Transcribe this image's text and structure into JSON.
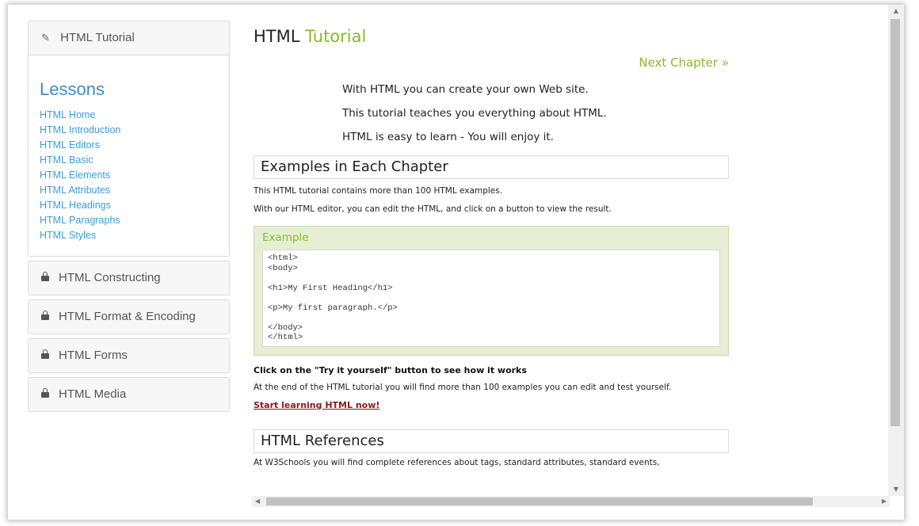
{
  "sidebar": {
    "header_label": "HTML Tutorial",
    "lessons_title": "Lessons",
    "lessons": [
      "HTML Home",
      "HTML Introduction",
      "HTML Editors",
      "HTML Basic",
      "HTML Elements",
      "HTML Attributes",
      "HTML Headings",
      "HTML Paragraphs",
      "HTML Styles"
    ],
    "locked_sections": [
      "HTML Constructing",
      "HTML Format & Encoding",
      "HTML Forms",
      "HTML Media"
    ]
  },
  "main": {
    "title_part1": "HTML",
    "title_part2": "Tutorial",
    "next_chapter": "Next Chapter »",
    "intro": [
      "With HTML you can create your own Web site.",
      "This tutorial teaches you everything about HTML.",
      "HTML is easy to learn - You will enjoy it."
    ],
    "section1_title": "Examples in Each Chapter",
    "section1_p1": "This HTML tutorial contains more than 100 HTML examples.",
    "section1_p2": "With our HTML editor, you can edit the HTML, and click on a button to view the result.",
    "example_title": "Example",
    "example_code": "<html>\n<body>\n\n<h1>My First Heading</h1>\n\n<p>My first paragraph.</p>\n\n</body>\n</html>",
    "try_text": "Click on the \"Try it yourself\" button to see how it works",
    "end_text": "At the end of the HTML tutorial you will find more than 100 examples you can edit and test yourself.",
    "start_link": "Start learning HTML now!",
    "section2_title": "HTML References",
    "section2_p1": "At W3Schools you will find complete references about tags, standard attributes, standard events,"
  },
  "colors": {
    "accent_green": "#8ab92d",
    "link_blue": "#3a9ddd",
    "start_link_red": "#8b1a1a"
  }
}
